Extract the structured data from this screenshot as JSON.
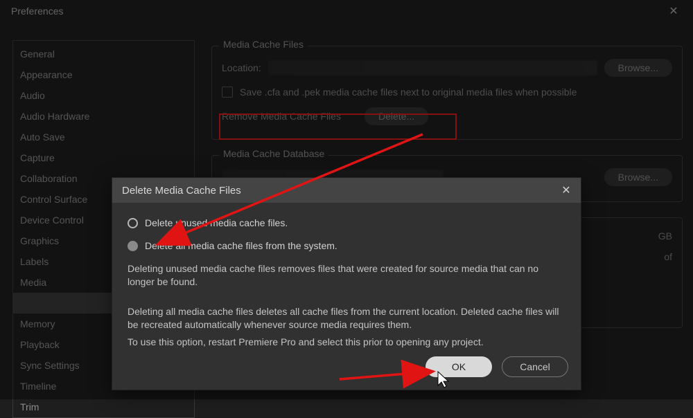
{
  "window": {
    "title": "Preferences"
  },
  "sidebar": {
    "items": [
      {
        "label": "General"
      },
      {
        "label": "Appearance"
      },
      {
        "label": "Audio"
      },
      {
        "label": "Audio Hardware"
      },
      {
        "label": "Auto Save"
      },
      {
        "label": "Capture"
      },
      {
        "label": "Collaboration"
      },
      {
        "label": "Control Surface"
      },
      {
        "label": "Device Control"
      },
      {
        "label": "Graphics"
      },
      {
        "label": "Labels"
      },
      {
        "label": "Media"
      },
      {
        "label": ""
      },
      {
        "label": "Memory"
      },
      {
        "label": "Playback"
      },
      {
        "label": "Sync Settings"
      },
      {
        "label": "Timeline"
      },
      {
        "label": "Trim"
      }
    ],
    "selected_index": 12
  },
  "panel": {
    "group1_title": "Media Cache Files",
    "location_label": "Location:",
    "browse_label": "Browse...",
    "save_checkbox_label": "Save .cfa and .pek media cache files next to original media files when possible",
    "remove_label": "Remove Media Cache Files",
    "delete_label": "Delete...",
    "group2_title": "Media Cache Database",
    "gb_suffix": "GB",
    "of_suffix": "of"
  },
  "modal": {
    "title": "Delete Media Cache Files",
    "option_unused": "Delete unused media cache files.",
    "option_all": "Delete all media cache files from the system.",
    "desc1": "Deleting unused media cache files removes files that were created for source media that can no longer be found.",
    "desc2a": "Deleting all media cache files deletes all cache files from the current location. Deleted cache files will be recreated automatically whenever source media requires them.",
    "desc2b": "To use this option, restart Premiere Pro and select this prior to opening any project.",
    "ok_label": "OK",
    "cancel_label": "Cancel"
  },
  "annotation": {
    "arrow_color": "#e11414"
  }
}
